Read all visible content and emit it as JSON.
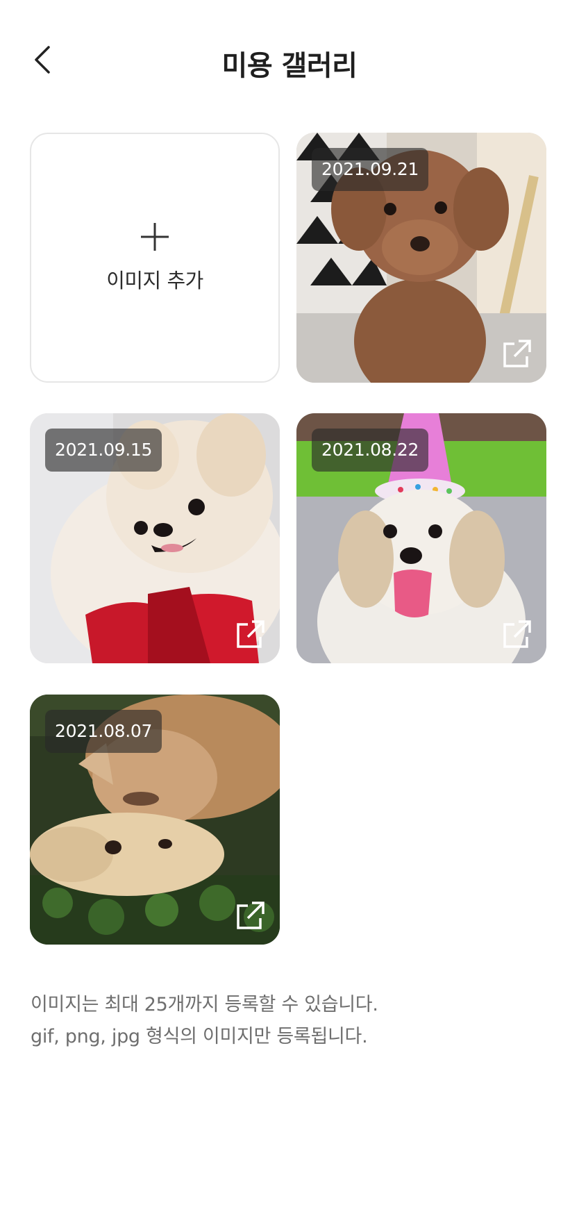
{
  "header": {
    "title": "미용 갤러리",
    "back_icon": "chevron-left-icon"
  },
  "gallery": {
    "add_tile": {
      "icon": "plus-icon",
      "label": "이미지 추가"
    },
    "items": [
      {
        "date": "2021.09.21",
        "subject": "brown poodle",
        "open_icon": "external-link-icon"
      },
      {
        "date": "2021.09.15",
        "subject": "white pomeranian",
        "open_icon": "external-link-icon"
      },
      {
        "date": "2021.08.22",
        "subject": "dog with party hat",
        "open_icon": "external-link-icon"
      },
      {
        "date": "2021.08.07",
        "subject": "cat and dog",
        "open_icon": "external-link-icon"
      }
    ]
  },
  "notice": {
    "line1": "이미지는 최대 25개까지 등록할 수 있습니다.",
    "line2": "gif, png, jpg 형식의 이미지만 등록됩니다."
  },
  "colors": {
    "badge_bg": "rgba(40,40,40,0.62)",
    "text_primary": "#1f1f1f",
    "text_secondary": "#6e6e6e",
    "tile_border": "#e6e6e6"
  }
}
